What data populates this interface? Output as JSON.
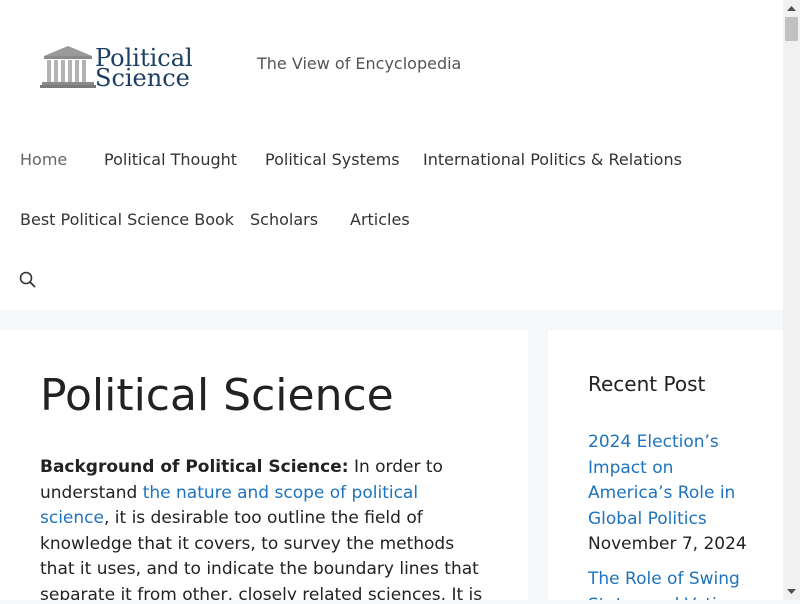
{
  "site": {
    "logo_line1": "Political",
    "logo_line2": "Science",
    "tagline": "The View of Encyclopedia"
  },
  "nav": {
    "items": [
      {
        "label": "Home"
      },
      {
        "label": "Political Thought"
      },
      {
        "label": "Political Systems"
      },
      {
        "label": "International Politics & Relations"
      },
      {
        "label": "Best Political Science Book"
      },
      {
        "label": "Scholars"
      },
      {
        "label": "Articles"
      }
    ],
    "search_icon": "search-icon"
  },
  "main": {
    "title": "Political Science",
    "intro_bold": "Background of Political Science:",
    "intro_text1": " In order to understand ",
    "intro_link": "the nature and scope of political science",
    "intro_text2": ", it is desirable too outline the field of knowledge that it covers, to survey the methods that it uses, and to indicate the boundary lines that separate it from other, closely related sciences. It is also necessary to define"
  },
  "sidebar": {
    "widget_title": "Recent Post",
    "posts": [
      {
        "title": "2024 Election’s Impact on America’s Role in Global Politics",
        "date": "November 7, 2024"
      },
      {
        "title": "The Role of Swing States and Voting"
      }
    ]
  },
  "colors": {
    "link": "#1e73be",
    "logo": "#1c3f63",
    "background": "#f7f8f9"
  }
}
